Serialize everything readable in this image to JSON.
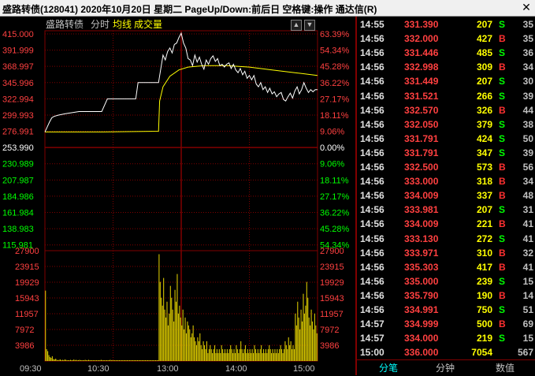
{
  "window": {
    "title": "盛路转债(128041)  2020年10月20日 星期二  PageUp/Down:前后日  空格键:操作  通达信(R)",
    "close_label": "✕"
  },
  "chart_header": {
    "name": "盛路转债",
    "mode": "分时",
    "avg_label": "均线",
    "vol_label": "成交量"
  },
  "colors": {
    "up": "#ff4040",
    "down": "#00ff00",
    "neutral": "#ffffff",
    "avg_line": "#ffff00",
    "grid": "#800000",
    "volume": "#d4c400",
    "accent": "#00ffff"
  },
  "chart_data": {
    "type": "line",
    "prev_close": 253.99,
    "price_ticks_left": [
      "415.000",
      "391.999",
      "368.997",
      "345.996",
      "322.994",
      "299.993",
      "276.991",
      "253.990",
      "230.989",
      "207.987",
      "184.986",
      "161.984",
      "138.983",
      "115.981"
    ],
    "pct_ticks_right": [
      "63.39%",
      "54.34%",
      "45.28%",
      "36.22%",
      "27.17%",
      "18.11%",
      "9.06%",
      "0.00%",
      "9.06%",
      "18.11%",
      "27.17%",
      "36.22%",
      "45.28%",
      "54.34%"
    ],
    "volume_ticks": [
      "27900",
      "23915",
      "19929",
      "15943",
      "11957",
      "7972",
      "3986"
    ],
    "time_labels": [
      "09:30",
      "10:30",
      "13:00",
      "14:00",
      "15:00"
    ],
    "ylim_price": [
      115.981,
      415.0
    ],
    "ylim_volume": [
      0,
      27900
    ],
    "grid": true,
    "price_series": [
      {
        "t": 0,
        "p": 276
      },
      {
        "t": 2,
        "p": 283
      },
      {
        "t": 4,
        "p": 290
      },
      {
        "t": 6,
        "p": 296
      },
      {
        "t": 8,
        "p": 298
      },
      {
        "t": 12,
        "p": 300
      },
      {
        "t": 18,
        "p": 302
      },
      {
        "t": 30,
        "p": 305
      },
      {
        "t": 50,
        "p": 305
      },
      {
        "t": 55,
        "p": 323
      },
      {
        "t": 80,
        "p": 323
      },
      {
        "t": 82,
        "p": 346
      },
      {
        "t": 100,
        "p": 346
      },
      {
        "t": 104,
        "p": 385
      },
      {
        "t": 106,
        "p": 378
      },
      {
        "t": 108,
        "p": 390
      },
      {
        "t": 110,
        "p": 395
      },
      {
        "t": 112,
        "p": 388
      },
      {
        "t": 114,
        "p": 400
      },
      {
        "t": 116,
        "p": 402
      },
      {
        "t": 118,
        "p": 410
      },
      {
        "t": 120,
        "p": 416
      },
      {
        "t": 122,
        "p": 402
      },
      {
        "t": 124,
        "p": 395
      },
      {
        "t": 126,
        "p": 380
      },
      {
        "t": 128,
        "p": 378
      },
      {
        "t": 130,
        "p": 370
      },
      {
        "t": 132,
        "p": 385
      },
      {
        "t": 134,
        "p": 375
      },
      {
        "t": 136,
        "p": 382
      },
      {
        "t": 138,
        "p": 372
      },
      {
        "t": 140,
        "p": 365
      },
      {
        "t": 142,
        "p": 378
      },
      {
        "t": 144,
        "p": 372
      },
      {
        "t": 146,
        "p": 380
      },
      {
        "t": 148,
        "p": 384
      },
      {
        "t": 150,
        "p": 376
      },
      {
        "t": 152,
        "p": 380
      },
      {
        "t": 154,
        "p": 370
      },
      {
        "t": 156,
        "p": 372
      },
      {
        "t": 158,
        "p": 368
      },
      {
        "t": 160,
        "p": 372
      },
      {
        "t": 162,
        "p": 374
      },
      {
        "t": 164,
        "p": 366
      },
      {
        "t": 166,
        "p": 372
      },
      {
        "t": 168,
        "p": 364
      },
      {
        "t": 170,
        "p": 360
      },
      {
        "t": 172,
        "p": 366
      },
      {
        "t": 174,
        "p": 357
      },
      {
        "t": 176,
        "p": 362
      },
      {
        "t": 178,
        "p": 352
      },
      {
        "t": 180,
        "p": 356
      },
      {
        "t": 182,
        "p": 350
      },
      {
        "t": 184,
        "p": 356
      },
      {
        "t": 186,
        "p": 344
      },
      {
        "t": 188,
        "p": 340
      },
      {
        "t": 190,
        "p": 346
      },
      {
        "t": 192,
        "p": 336
      },
      {
        "t": 194,
        "p": 340
      },
      {
        "t": 196,
        "p": 332
      },
      {
        "t": 198,
        "p": 338
      },
      {
        "t": 200,
        "p": 330
      },
      {
        "t": 202,
        "p": 333
      },
      {
        "t": 204,
        "p": 326
      },
      {
        "t": 206,
        "p": 330
      },
      {
        "t": 208,
        "p": 332
      },
      {
        "t": 210,
        "p": 322
      },
      {
        "t": 212,
        "p": 320
      },
      {
        "t": 214,
        "p": 326
      },
      {
        "t": 216,
        "p": 331
      },
      {
        "t": 218,
        "p": 324
      },
      {
        "t": 220,
        "p": 334
      },
      {
        "t": 222,
        "p": 340
      },
      {
        "t": 224,
        "p": 330
      },
      {
        "t": 226,
        "p": 336
      },
      {
        "t": 228,
        "p": 346
      },
      {
        "t": 230,
        "p": 338
      },
      {
        "t": 232,
        "p": 332
      },
      {
        "t": 234,
        "p": 336
      },
      {
        "t": 236,
        "p": 333
      },
      {
        "t": 238,
        "p": 336
      },
      {
        "t": 240,
        "p": 336
      }
    ],
    "avg_series": [
      {
        "t": 0,
        "p": 276
      },
      {
        "t": 50,
        "p": 276
      },
      {
        "t": 51,
        "p": 276
      },
      {
        "t": 100,
        "p": 277
      },
      {
        "t": 101,
        "p": 320
      },
      {
        "t": 104,
        "p": 340
      },
      {
        "t": 110,
        "p": 355
      },
      {
        "t": 118,
        "p": 364
      },
      {
        "t": 126,
        "p": 368
      },
      {
        "t": 140,
        "p": 370
      },
      {
        "t": 160,
        "p": 370
      },
      {
        "t": 180,
        "p": 368
      },
      {
        "t": 200,
        "p": 364
      },
      {
        "t": 220,
        "p": 360
      },
      {
        "t": 240,
        "p": 356
      }
    ],
    "volume_series": [
      17800,
      3000,
      2500,
      1500,
      1000,
      800,
      1200,
      500,
      400,
      600,
      300,
      200,
      300,
      400,
      200,
      300,
      200,
      400,
      300,
      200,
      200,
      200,
      300,
      200,
      200,
      400,
      200,
      300,
      200,
      200,
      300,
      200,
      200,
      200,
      200,
      300,
      200,
      200,
      300,
      200,
      200,
      200,
      200,
      200,
      200,
      200,
      200,
      200,
      200,
      300,
      200,
      200,
      200,
      200,
      200,
      200,
      200,
      300,
      200,
      200,
      200,
      200,
      200,
      200,
      200,
      200,
      200,
      200,
      200,
      200,
      200,
      200,
      200,
      200,
      200,
      200,
      200,
      200,
      200,
      200,
      200,
      200,
      200,
      200,
      200,
      200,
      200,
      200,
      200,
      200,
      200,
      200,
      200,
      200,
      200,
      200,
      200,
      200,
      200,
      200,
      27000,
      20000,
      16000,
      14000,
      21000,
      13000,
      11000,
      15000,
      9000,
      12000,
      19000,
      16000,
      13000,
      10000,
      18000,
      15000,
      22000,
      12000,
      14000,
      11000,
      9000,
      13000,
      8000,
      11000,
      7000,
      10000,
      9000,
      8000,
      6000,
      7000,
      9000,
      6000,
      5000,
      4000,
      6000,
      5000,
      7000,
      4000,
      3000,
      5000,
      4000,
      3000,
      5000,
      2000,
      3000,
      4000,
      3000,
      2000,
      3000,
      4000,
      2000,
      3000,
      2000,
      3000,
      2000,
      4000,
      3000,
      2000,
      3000,
      2000,
      3000,
      2000,
      3000,
      4000,
      3000,
      2000,
      3000,
      2000,
      4000,
      3000,
      2000,
      3000,
      5000,
      3000,
      2000,
      3000,
      4000,
      2000,
      3000,
      2000,
      3000,
      2000,
      3000,
      2000,
      4000,
      3000,
      2000,
      3000,
      2000,
      3000,
      4000,
      2000,
      3000,
      2000,
      3000,
      2000,
      3000,
      4000,
      3000,
      2000,
      3000,
      2000,
      3000,
      2000,
      3000,
      2000,
      3000,
      4000,
      3000,
      2000,
      3000,
      5000,
      4000,
      3000,
      6000,
      4000,
      5000,
      3000,
      4000,
      3000,
      12000,
      9000,
      15000,
      11000,
      8000,
      13000,
      10000,
      17000,
      12000,
      14000,
      20000,
      16000,
      11000,
      9000,
      13000,
      10000,
      8000,
      12000,
      9000,
      7000
    ]
  },
  "ticks": [
    {
      "time": "14:55",
      "price": "331.390",
      "vol": "207",
      "bs": "S",
      "cnt": "35"
    },
    {
      "time": "14:56",
      "price": "332.000",
      "vol": "427",
      "bs": "B",
      "cnt": "35"
    },
    {
      "time": "14:56",
      "price": "331.446",
      "vol": "485",
      "bs": "S",
      "cnt": "36"
    },
    {
      "time": "14:56",
      "price": "332.998",
      "vol": "309",
      "bs": "B",
      "cnt": "34"
    },
    {
      "time": "14:56",
      "price": "331.449",
      "vol": "207",
      "bs": "S",
      "cnt": "30"
    },
    {
      "time": "14:56",
      "price": "331.521",
      "vol": "266",
      "bs": "S",
      "cnt": "39"
    },
    {
      "time": "14:56",
      "price": "332.570",
      "vol": "326",
      "bs": "B",
      "cnt": "44"
    },
    {
      "time": "14:56",
      "price": "332.050",
      "vol": "379",
      "bs": "S",
      "cnt": "38"
    },
    {
      "time": "14:56",
      "price": "331.791",
      "vol": "424",
      "bs": "S",
      "cnt": "50"
    },
    {
      "time": "14:56",
      "price": "331.791",
      "vol": "347",
      "bs": "S",
      "cnt": "39"
    },
    {
      "time": "14:56",
      "price": "332.500",
      "vol": "573",
      "bs": "B",
      "cnt": "56"
    },
    {
      "time": "14:56",
      "price": "333.000",
      "vol": "318",
      "bs": "B",
      "cnt": "34"
    },
    {
      "time": "14:56",
      "price": "334.009",
      "vol": "337",
      "bs": "B",
      "cnt": "48"
    },
    {
      "time": "14:56",
      "price": "333.981",
      "vol": "207",
      "bs": "S",
      "cnt": "31"
    },
    {
      "time": "14:56",
      "price": "334.009",
      "vol": "221",
      "bs": "B",
      "cnt": "41"
    },
    {
      "time": "14:56",
      "price": "333.130",
      "vol": "272",
      "bs": "S",
      "cnt": "41"
    },
    {
      "time": "14:56",
      "price": "333.971",
      "vol": "310",
      "bs": "B",
      "cnt": "32"
    },
    {
      "time": "14:56",
      "price": "335.303",
      "vol": "417",
      "bs": "B",
      "cnt": "41"
    },
    {
      "time": "14:56",
      "price": "335.000",
      "vol": "239",
      "bs": "S",
      "cnt": "15"
    },
    {
      "time": "14:56",
      "price": "335.790",
      "vol": "190",
      "bs": "B",
      "cnt": "14"
    },
    {
      "time": "14:56",
      "price": "334.991",
      "vol": "750",
      "bs": "S",
      "cnt": "51"
    },
    {
      "time": "14:57",
      "price": "334.999",
      "vol": "500",
      "bs": "B",
      "cnt": "69"
    },
    {
      "time": "14:57",
      "price": "334.000",
      "vol": "219",
      "bs": "S",
      "cnt": "15"
    },
    {
      "time": "15:00",
      "price": "336.000",
      "vol": "7054",
      "bs": "",
      "cnt": "567"
    }
  ],
  "bottom_tabs": [
    {
      "label": "分笔",
      "active": true
    },
    {
      "label": "分钟",
      "active": false
    },
    {
      "label": "数值",
      "active": false
    }
  ]
}
